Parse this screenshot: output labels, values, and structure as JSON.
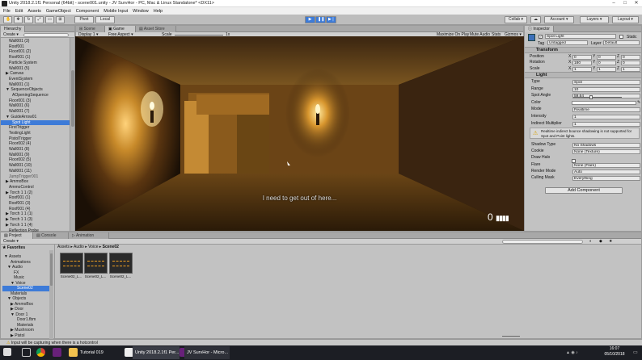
{
  "window": {
    "title": "Unity 2018.2.1f1 Personal (64bit) - scene001.unity - JV SurvHor - PC, Mac & Linux Standalone* <DX11>"
  },
  "menu": [
    "File",
    "Edit",
    "Assets",
    "GameObject",
    "Component",
    "Mobile Input",
    "Window",
    "Help"
  ],
  "toolbar": {
    "pivot": "Pivot",
    "space": "Local",
    "collab": "Collab ▾",
    "account": "Account",
    "layers": "Layers",
    "layout": "Layout"
  },
  "hierarchy": {
    "tab": "Hierarchy",
    "create": "Create ▾",
    "rows": [
      {
        "label": "Wall001 (3)",
        "indent": 2
      },
      {
        "label": "Roof001",
        "indent": 2
      },
      {
        "label": "Floor001 (2)",
        "indent": 2
      },
      {
        "label": "Roof001 (1)",
        "indent": 2
      },
      {
        "label": "Particle System",
        "indent": 2
      },
      {
        "label": "Wall001 (5)",
        "indent": 2
      },
      {
        "label": "▶ Canvas",
        "indent": 1
      },
      {
        "label": "EventSystem",
        "indent": 2
      },
      {
        "label": "Wall001 (1)",
        "indent": 2
      },
      {
        "label": "▼ SequenceObjects",
        "indent": 1
      },
      {
        "label": "AOpeningSequence",
        "indent": 3
      },
      {
        "label": "Floor001 (3)",
        "indent": 2
      },
      {
        "label": "Wall001 (6)",
        "indent": 2
      },
      {
        "label": "Wall001 (7)",
        "indent": 2
      },
      {
        "label": "▼ GuideArrow01",
        "indent": 1
      },
      {
        "label": "Spot Light",
        "indent": 3,
        "selected": true
      },
      {
        "label": "FirstTrigger",
        "indent": 2
      },
      {
        "label": "TestingLight",
        "indent": 2
      },
      {
        "label": "PistolTrigger",
        "indent": 2
      },
      {
        "label": "Floor002 (4)",
        "indent": 2
      },
      {
        "label": "Wall001 (8)",
        "indent": 2
      },
      {
        "label": "Wall001 (9)",
        "indent": 2
      },
      {
        "label": "Floor002 (5)",
        "indent": 2
      },
      {
        "label": "Wall001 (10)",
        "indent": 2
      },
      {
        "label": "Wall001 (11)",
        "indent": 2
      },
      {
        "label": "JumpTrigger001",
        "indent": 2,
        "dim": true
      },
      {
        "label": "▶ AmmoBox",
        "indent": 1
      },
      {
        "label": "AmmoControl",
        "indent": 2
      },
      {
        "label": "▶ Torch 1 1 (2)",
        "indent": 1
      },
      {
        "label": "Roof001 (1)",
        "indent": 2
      },
      {
        "label": "Roof001 (3)",
        "indent": 2
      },
      {
        "label": "Roof001 (4)",
        "indent": 2
      },
      {
        "label": "▶ Torch 1 1 (1)",
        "indent": 1
      },
      {
        "label": "▶ Torch 1 1 (3)",
        "indent": 1
      },
      {
        "label": "▶ Torch 1 1 (4)",
        "indent": 1
      },
      {
        "label": "Reflection Probe",
        "indent": 2
      }
    ]
  },
  "center": {
    "tabs": [
      "Scene",
      "Game",
      "Asset Store"
    ],
    "display": "Display 1 ▾",
    "aspect": "Free Aspect ▾",
    "scale_label": "Scale",
    "scale_value": "1x",
    "toggles": [
      "Maximize On Play",
      "Mute Audio",
      "Stats",
      "Gizmos ▾"
    ],
    "subtitle": "I need to get out of here...",
    "ammo": "0"
  },
  "project": {
    "tabs": [
      "Project",
      "Console",
      "Animation"
    ],
    "create": "Create ▾",
    "favorites": "Favorites",
    "breadcrumb": [
      "Assets",
      "Audio",
      "Voice",
      "Scene02"
    ],
    "tree": [
      {
        "label": "▼ Assets",
        "indent": 0
      },
      {
        "label": "Animations",
        "indent": 2
      },
      {
        "label": "▼ Audio",
        "indent": 1
      },
      {
        "label": "FX",
        "indent": 3
      },
      {
        "label": "Music",
        "indent": 3
      },
      {
        "label": "▼ Voice",
        "indent": 2
      },
      {
        "label": "Scene02",
        "indent": 4,
        "selected": true
      },
      {
        "label": "Materials",
        "indent": 2
      },
      {
        "label": "▼ Objects",
        "indent": 1
      },
      {
        "label": "▶ AmmoBox",
        "indent": 2
      },
      {
        "label": "▶ Door",
        "indent": 2
      },
      {
        "label": "▼ Door 1",
        "indent": 2
      },
      {
        "label": "Door1.fbm",
        "indent": 4
      },
      {
        "label": "Materials",
        "indent": 4
      },
      {
        "label": "▶ Mushroom",
        "indent": 2
      },
      {
        "label": "▶ Pistol",
        "indent": 2
      }
    ],
    "assets": [
      "Scene02_L...",
      "Scene02_L...",
      "Scene02_L..."
    ]
  },
  "inspector": {
    "tab": "Inspector",
    "object_name": "Spot Light",
    "static_label": "Static",
    "tag_label": "Tag",
    "tag_value": "Untagged",
    "layer_label": "Layer",
    "layer_value": "Default",
    "transform": {
      "title": "Transform",
      "rows": [
        {
          "label": "Position",
          "x": "0",
          "y": "0",
          "z": "0"
        },
        {
          "label": "Rotation",
          "x": "180",
          "y": "0",
          "z": "0"
        },
        {
          "label": "Scale",
          "x": "1",
          "y": "1",
          "z": "1"
        }
      ]
    },
    "light": {
      "title": "Light",
      "props": [
        {
          "label": "Type",
          "value": "Spot"
        },
        {
          "label": "Range",
          "value": "10"
        },
        {
          "label": "Spot Angle",
          "value": "59.64"
        },
        {
          "label": "Color",
          "value": ""
        },
        {
          "label": "Mode",
          "value": "Realtime"
        },
        {
          "label": "Intensity",
          "value": "1"
        },
        {
          "label": "Indirect Multiplier",
          "value": "1"
        }
      ],
      "warning": "Realtime indirect bounce shadowing is not supported for Spot and Point lights.",
      "props2": [
        {
          "label": "Shadow Type",
          "value": "No Shadows"
        },
        {
          "label": "Cookie",
          "value": "None (Texture)"
        },
        {
          "label": "Draw Halo",
          "value": ""
        },
        {
          "label": "Flare",
          "value": "None (Flare)"
        },
        {
          "label": "Render Mode",
          "value": "Auto"
        },
        {
          "label": "Culling Mask",
          "value": "Everything"
        }
      ]
    },
    "add_component": "Add Component"
  },
  "status": "Input will be capturing when there is a hotcontrol",
  "taskbar": {
    "items": [
      "Tutorial 019",
      "Unity 2018.2.1f1 Per...",
      "JV SurvHor - Micro..."
    ],
    "time": "16:07",
    "date": "05/10/2018"
  },
  "colors": {
    "selection": "#3d7bd8",
    "play_active": "#3d7bd8",
    "panel": "#c2c2c2",
    "torch": "#ffb13a"
  }
}
